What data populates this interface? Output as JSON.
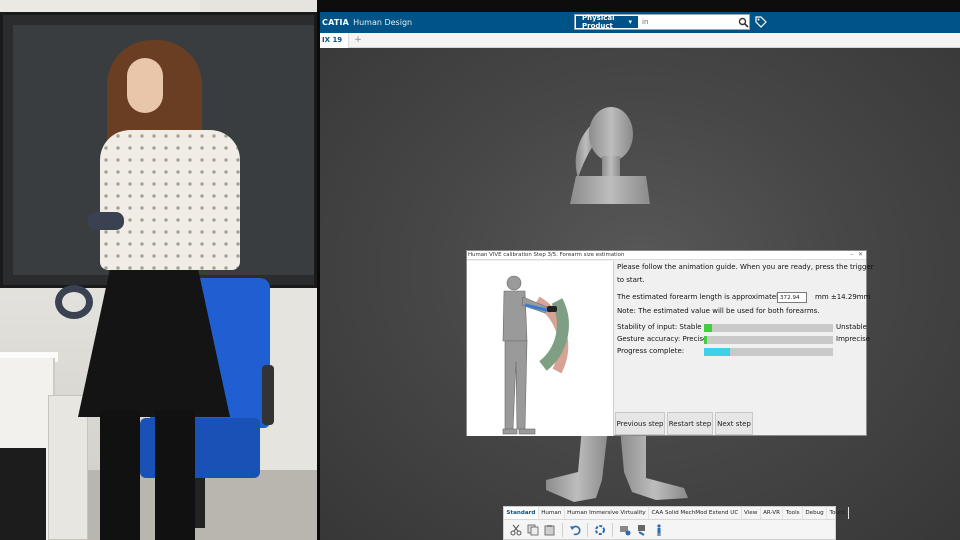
{
  "app": {
    "brand": "CATIA",
    "module": "Human Design",
    "search": {
      "scope": "Physical Product",
      "value": "in"
    },
    "tab": {
      "label": "IX 19",
      "add": "+"
    }
  },
  "dialog": {
    "title": "Human VIVE calibration Step 3/5. Forearm size estimation",
    "instruction_line1": "Please follow the animation guide. When you are ready, press the trigger",
    "instruction_line2": "to start.",
    "estimate_label": "The estimated forearm length is approximately",
    "estimate_value": "372.94",
    "estimate_unit": "mm ±14.29mm",
    "note": "Note: The estimated value will be used for both forearms.",
    "stability": {
      "label": "Stability of input: Stable",
      "right": "Unstable",
      "level": 0.06,
      "color": "#3fcf3f"
    },
    "accuracy": {
      "label": "Gesture accuracy: Precise",
      "right": "Imprecise",
      "level": 0.02,
      "color": "#3fcf3f"
    },
    "progress": {
      "label": "Progress complete:",
      "level": 0.2,
      "color": "#3fd0e8"
    },
    "buttons": {
      "previous": "Previous step",
      "restart": "Restart step",
      "next": "Next step"
    }
  },
  "toolbar": {
    "tabs": [
      "Standard",
      "Human",
      "Human Immersive Virtuality",
      "CAA Solid MechMod Extend UC",
      "View",
      "AR-VR",
      "Tools",
      "Debug",
      "Touch"
    ],
    "icons": [
      "cut-icon",
      "copy-icon",
      "paste-icon",
      "undo-icon",
      "update-icon",
      "human-calibration-icon",
      "human-posture-icon",
      "manikin-icon"
    ]
  },
  "colors": {
    "brand": "#005386",
    "viewport": "#474747"
  }
}
